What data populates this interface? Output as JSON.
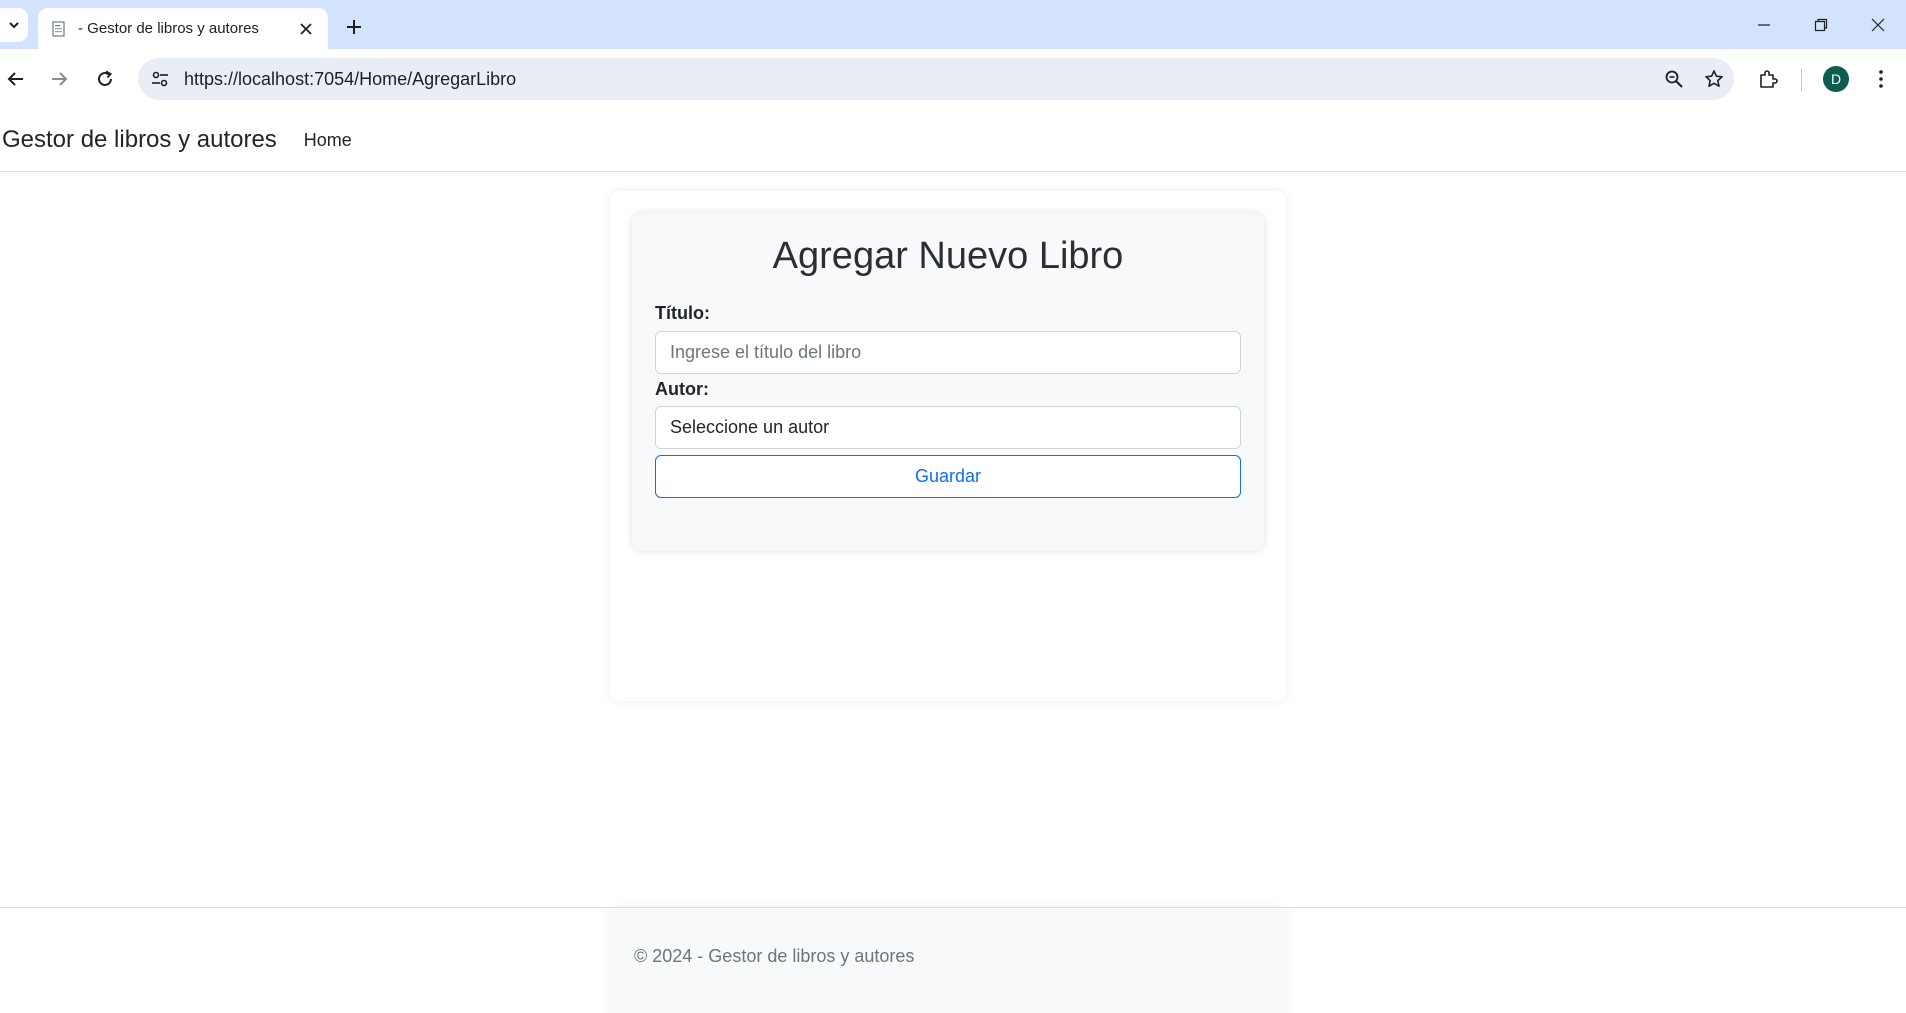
{
  "browser": {
    "tab_title": "- Gestor de libros y autores",
    "url": "https://localhost:7054/Home/AgregarLibro",
    "profile_initial": "D",
    "icons": {
      "tab_menu": "chevron-down-icon",
      "favicon": "page-icon",
      "tab_close": "close-icon",
      "new_tab": "plus-icon",
      "minimize": "minimize-icon",
      "restore": "restore-icon",
      "close_window": "close-icon",
      "back": "arrow-left-icon",
      "forward": "arrow-right-icon",
      "reload": "reload-icon",
      "site_info": "tune-icon",
      "zoom": "zoom-out-icon",
      "bookmark": "star-icon",
      "extensions": "puzzle-icon",
      "menu": "kebab-icon"
    }
  },
  "site": {
    "brand": "Gestor de libros y autores",
    "nav_home": "Home"
  },
  "form": {
    "title": "Agregar Nuevo Libro",
    "titulo_label": "Título:",
    "titulo_placeholder": "Ingrese el título del libro",
    "titulo_value": "",
    "autor_label": "Autor:",
    "autor_selected": "Seleccione un autor",
    "save_label": "Guardar"
  },
  "footer": {
    "text": "© 2024 - Gestor de libros y autores"
  },
  "colors": {
    "tabstrip": "#d3e3fd",
    "omnibox": "#e9eef6",
    "primary": "#0d6efd",
    "avatar": "#0b5d4f",
    "card_bg": "#f8f9fa"
  }
}
